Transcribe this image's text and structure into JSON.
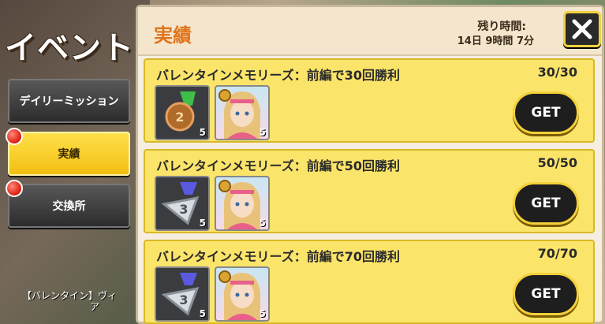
{
  "sidebar": {
    "event_title": "イベント",
    "items": [
      {
        "label": "デイリーミッション",
        "active": false,
        "badge": false
      },
      {
        "label": "実績",
        "active": true,
        "badge": true
      },
      {
        "label": "交換所",
        "active": false,
        "badge": true
      }
    ],
    "bottom_caption_line1": "【バレンタイン】ヴィ",
    "bottom_caption_line2": "ア"
  },
  "panel": {
    "title": "実績",
    "remaining_label": "残り時間:",
    "remaining_value": "14日 9時間 7分",
    "close_icon": "close-x-icon"
  },
  "achievements": [
    {
      "title": "バレンタインメモリーズ：前編で30回勝利",
      "progress": "30/30",
      "button": "GET",
      "rewards": [
        {
          "icon": "bronze-medal-icon",
          "count": "5"
        },
        {
          "icon": "character-portrait-icon",
          "count": "5"
        }
      ]
    },
    {
      "title": "バレンタインメモリーズ：前編で50回勝利",
      "progress": "50/50",
      "button": "GET",
      "rewards": [
        {
          "icon": "silver-medal-3-icon",
          "count": "5"
        },
        {
          "icon": "character-portrait-icon",
          "count": "5"
        }
      ]
    },
    {
      "title": "バレンタインメモリーズ：前編で70回勝利",
      "progress": "70/70",
      "button": "GET",
      "rewards": [
        {
          "icon": "silver-medal-3-icon",
          "count": "5"
        },
        {
          "icon": "character-portrait-icon",
          "count": "5"
        }
      ]
    }
  ],
  "colors": {
    "accent_yellow": "#fbe46a",
    "title_orange": "#e0731a",
    "button_dark": "#1e1e1e",
    "badge_red": "#e32a1a"
  }
}
